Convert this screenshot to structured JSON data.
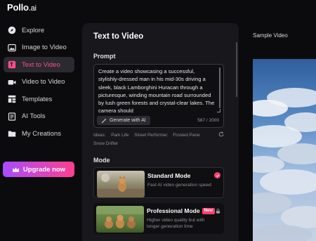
{
  "brand": {
    "name": "Pollo",
    "suffix": ".ai"
  },
  "sidebar": {
    "items": [
      {
        "label": "Explore",
        "icon": "compass-icon",
        "active": false
      },
      {
        "label": "Image to Video",
        "icon": "image-icon",
        "active": false
      },
      {
        "label": "Text to Video",
        "icon": "text-video-icon",
        "active": true
      },
      {
        "label": "Video to Video",
        "icon": "video-camera-icon",
        "active": false
      },
      {
        "label": "Templates",
        "icon": "templates-icon",
        "active": false
      },
      {
        "label": "AI Tools",
        "icon": "tools-icon",
        "active": false
      },
      {
        "label": "My Creations",
        "icon": "folder-icon",
        "active": false
      }
    ],
    "upgrade_label": "Upgrade now"
  },
  "panel": {
    "title": "Text to Video",
    "prompt_label": "Prompt",
    "prompt_text": "Create a video showcasing a successful, stylishly-dressed man in his mid-30s driving a sleek, black Lamborghini Huracan through a picturesque, winding mountain road surrounded by lush green forests and crystal-clear lakes. The camera should",
    "generate_ai_label": "Generate with AI",
    "char_count": "567 / 2000",
    "ideas_label": "Ideas:",
    "ideas": [
      "Park Life",
      "Street Performer",
      "Frosted Pane",
      "Snow Drifter"
    ],
    "mode_label": "Mode",
    "modes": [
      {
        "name": "Standard Mode",
        "description": "Fast AI video generation speed",
        "selected": true,
        "badge": ""
      },
      {
        "name": "Professional Mode",
        "description": "Higher video quality but with longer generation time",
        "selected": false,
        "badge": "New"
      }
    ]
  },
  "preview": {
    "label": "Sample Video"
  },
  "colors": {
    "accent": "#ff3f6e",
    "active_text": "#ff4d8d",
    "upgrade_start": "#a74cff",
    "upgrade_end": "#ff3f8e"
  }
}
